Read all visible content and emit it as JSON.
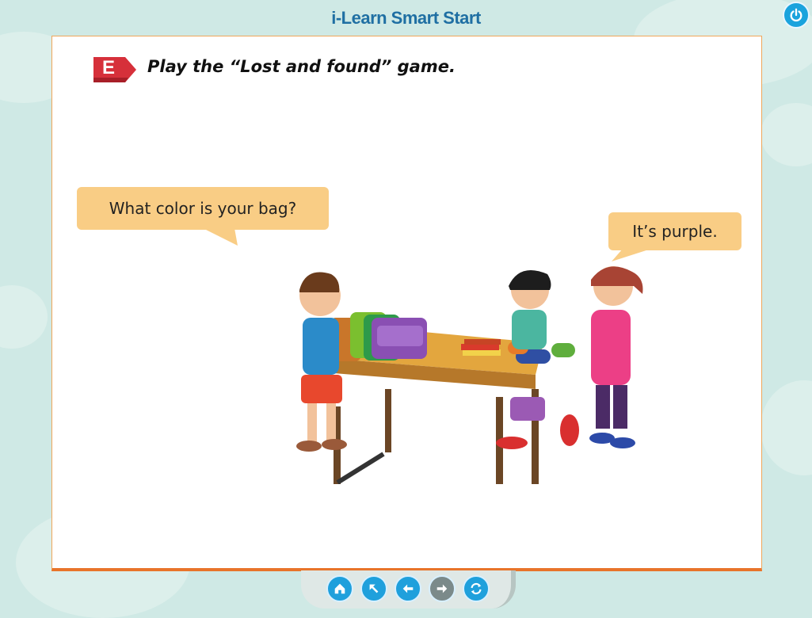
{
  "app": {
    "title": "i-Learn Smart Start"
  },
  "section": {
    "badge": "E",
    "instruction": "Play the “Lost and found” game."
  },
  "dialogue": {
    "question": "What color is your bag?",
    "answer": "It’s purple."
  },
  "navigation": {
    "buttons": [
      {
        "name": "home-icon",
        "enabled": true
      },
      {
        "name": "back-to-menu-icon",
        "enabled": true
      },
      {
        "name": "previous-arrow-icon",
        "enabled": true
      },
      {
        "name": "next-arrow-icon",
        "enabled": false
      },
      {
        "name": "replay-icon",
        "enabled": true
      }
    ]
  },
  "colors": {
    "accent": "#1fa0dc",
    "page_border": "#e8742a",
    "bubble": "#f9cd85",
    "badge": "#d6303a"
  }
}
